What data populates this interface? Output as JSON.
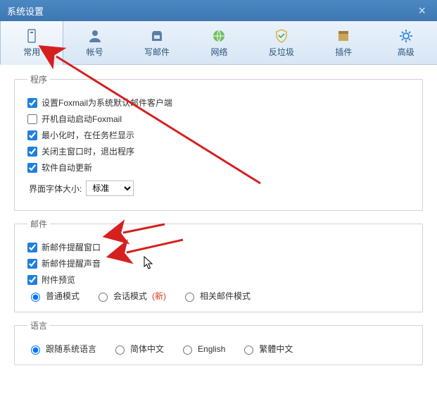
{
  "window": {
    "title": "系统设置"
  },
  "tabs": {
    "general": "常用",
    "account": "帐号",
    "compose": "写邮件",
    "network": "网络",
    "antispam": "反垃圾",
    "plugin": "插件",
    "advanced": "高级"
  },
  "program": {
    "legend": "程序",
    "default_client": "设置Foxmail为系统默认邮件客户端",
    "autostart": "开机自动启动Foxmail",
    "minimize_tray": "最小化时，在任务栏显示",
    "exit_on_close": "关闭主窗口时，退出程序",
    "auto_update": "软件自动更新",
    "font_size_label": "界面字体大小:",
    "font_size_value": "标准"
  },
  "mail": {
    "legend": "邮件",
    "popup": "新邮件提醒窗口",
    "sound": "新邮件提醒声音",
    "attach_preview": "附件预览",
    "mode_normal": "普通模式",
    "mode_conversation": "会话模式",
    "new_tag": "(新)",
    "mode_related": "相关邮件模式"
  },
  "language": {
    "legend": "语言",
    "system": "跟随系统语言",
    "simplified": "简体中文",
    "english": "English",
    "traditional": "繁體中文"
  }
}
